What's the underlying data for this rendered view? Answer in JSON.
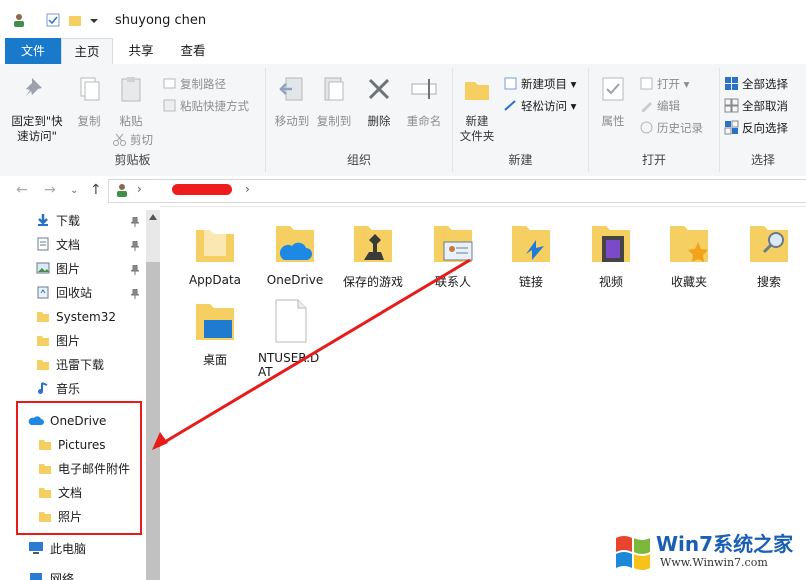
{
  "window": {
    "title": "shuyong chen"
  },
  "tabs": [
    {
      "label": "文件"
    },
    {
      "label": "主页"
    },
    {
      "label": "共享"
    },
    {
      "label": "查看"
    }
  ],
  "ribbon": {
    "clipboard": {
      "pin_label_1": "固定到\"快",
      "pin_label_2": "速访问\"",
      "copy": "复制",
      "paste": "粘贴",
      "copy_path": "复制路径",
      "paste_shortcut": "粘贴快捷方式",
      "cut": "剪切",
      "group": "剪贴板"
    },
    "organize": {
      "move_to": "移动到",
      "copy_to": "复制到",
      "delete": "删除",
      "rename": "重命名",
      "group": "组织"
    },
    "new": {
      "new_folder_1": "新建",
      "new_folder_2": "文件夹",
      "new_item": "新建项目",
      "easy_access": "轻松访问",
      "group": "新建"
    },
    "open": {
      "properties": "属性",
      "open": "打开",
      "edit": "编辑",
      "history": "历史记录",
      "group": "打开"
    },
    "select": {
      "select_all": "全部选择",
      "select_none": "全部取消",
      "invert": "反向选择",
      "group": "选择"
    }
  },
  "sidebar": {
    "quick": [
      {
        "label": "下载"
      },
      {
        "label": "文档"
      },
      {
        "label": "图片"
      },
      {
        "label": "回收站"
      },
      {
        "label": "System32"
      },
      {
        "label": "图片"
      },
      {
        "label": "迅雷下载"
      },
      {
        "label": "音乐"
      }
    ],
    "onedrive": {
      "label": "OneDrive"
    },
    "onedrive_children": [
      {
        "label": "Pictures"
      },
      {
        "label": "电子邮件附件"
      },
      {
        "label": "文档"
      },
      {
        "label": "照片"
      }
    ],
    "this_pc": {
      "label": "此电脑"
    },
    "network": {
      "label": "网络"
    }
  },
  "files": [
    {
      "name": "AppData"
    },
    {
      "name": "OneDrive"
    },
    {
      "name": "保存的游戏"
    },
    {
      "name": "联系人"
    },
    {
      "name": "链接"
    },
    {
      "name": "视频"
    },
    {
      "name": "收藏夹"
    },
    {
      "name": "搜索"
    },
    {
      "name": "桌面"
    },
    {
      "name": "NTUSER.DAT"
    }
  ],
  "watermark": {
    "brand": "Win7系统之家",
    "url": "Www.Winwin7.com"
  },
  "colors": {
    "accent": "#1979ca",
    "folder": "#f6cf62",
    "annotation": "#e81a1a"
  }
}
